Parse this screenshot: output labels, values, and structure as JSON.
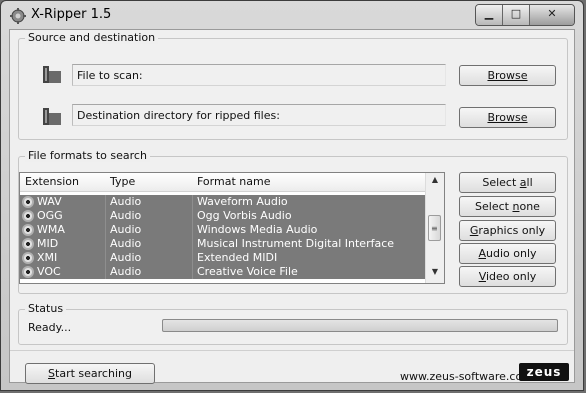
{
  "window": {
    "title": "X-Ripper 1.5",
    "caption_buttons": [
      "minimize",
      "maximize",
      "close"
    ]
  },
  "source_group": {
    "label": "Source and destination",
    "file_to_scan_label": "File to scan:",
    "destination_label": "Destination directory for ripped files:",
    "browse_label_1": "Browse",
    "browse_label_2": "Browse"
  },
  "formats_group": {
    "label": "File formats to search",
    "columns": [
      "Extension",
      "Type",
      "Format name"
    ],
    "rows": [
      {
        "ext": "WAV",
        "type": "Audio",
        "name": "Waveform Audio"
      },
      {
        "ext": "OGG",
        "type": "Audio",
        "name": "Ogg Vorbis Audio"
      },
      {
        "ext": "WMA",
        "type": "Audio",
        "name": "Windows Media Audio"
      },
      {
        "ext": "MID",
        "type": "Audio",
        "name": "Musical Instrument Digital Interface"
      },
      {
        "ext": "XMI",
        "type": "Audio",
        "name": "Extended MIDI"
      },
      {
        "ext": "VOC",
        "type": "Audio",
        "name": "Creative Voice File"
      }
    ],
    "buttons": {
      "select_all": "Select all",
      "select_none": "Select none",
      "graphics_only": "Graphics only",
      "audio_only": "Audio only",
      "video_only": "Video only"
    }
  },
  "status_group": {
    "label": "Status",
    "status_text": "Ready...",
    "progress": 0
  },
  "footer": {
    "start_label": "Start searching",
    "url": "www.zeus-software.com",
    "logo_text": "zeus"
  },
  "colors": {
    "selected_row": "#7a7a7a",
    "window_bg": "#efefef"
  },
  "icons": [
    "gear-icon",
    "folder-icon",
    "cd-icon",
    "scroll-up-arrow-icon",
    "scroll-down-arrow-icon"
  ]
}
